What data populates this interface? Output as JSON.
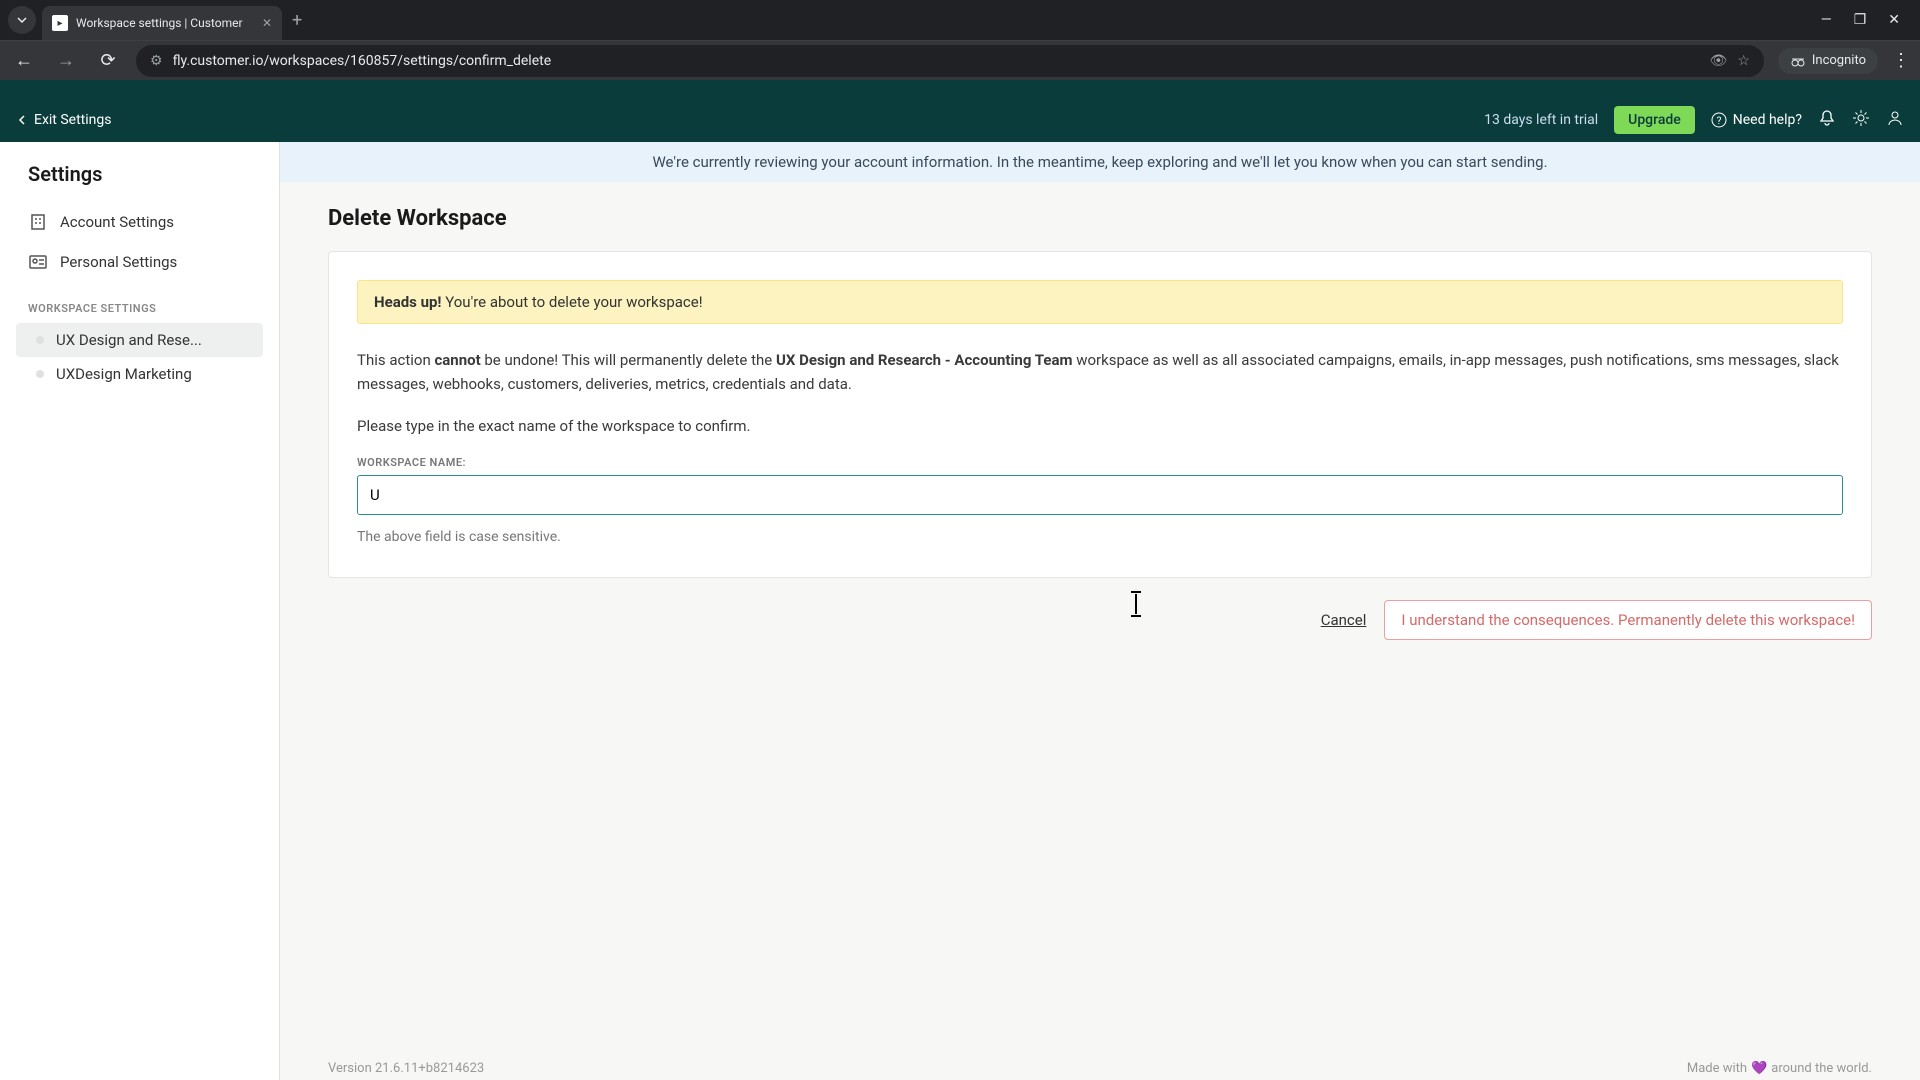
{
  "browser": {
    "tab_title": "Workspace settings | Customer",
    "url": "fly.customer.io/workspaces/160857/settings/confirm_delete",
    "incognito_label": "Incognito"
  },
  "header": {
    "exit_label": "Exit Settings",
    "trial_text": "13 days left in trial",
    "upgrade_label": "Upgrade",
    "help_label": "Need help?"
  },
  "sidebar": {
    "title": "Settings",
    "items": [
      {
        "label": "Account Settings"
      },
      {
        "label": "Personal Settings"
      }
    ],
    "section_label": "WORKSPACE SETTINGS",
    "workspaces": [
      {
        "label": "UX Design and Rese...",
        "active": true
      },
      {
        "label": "UXDesign Marketing",
        "active": false
      }
    ]
  },
  "banner": {
    "text": "We're currently reviewing your account information. In the meantime, keep exploring and we'll let you know when you can start sending."
  },
  "page": {
    "title": "Delete Workspace",
    "warning_strong": "Heads up!",
    "warning_text": " You're about to delete your workspace!",
    "para1_a": "This action ",
    "para1_b": "cannot",
    "para1_c": " be undone! This will permanently delete the ",
    "para1_d": "UX Design and Research - Accounting Team",
    "para1_e": " workspace as well as all associated campaigns, emails, in-app messages, push notifications, sms messages, slack messages, webhooks, customers, deliveries, metrics, credentials and data.",
    "para2": "Please type in the exact name of the workspace to confirm.",
    "field_label": "WORKSPACE NAME:",
    "input_value": "U",
    "hint": "The above field is case sensitive.",
    "cancel_label": "Cancel",
    "delete_label": "I understand the consequences. Permanently delete this workspace!"
  },
  "footer": {
    "version": "Version 21.6.11+b8214623",
    "made_with_a": "Made with ",
    "made_with_b": " around the world."
  }
}
